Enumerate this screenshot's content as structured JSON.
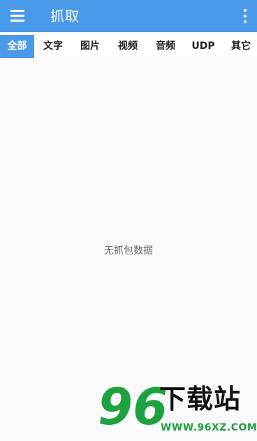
{
  "app_bar": {
    "title": "抓取",
    "menu_icon": "hamburger-menu-icon",
    "more_icon": "more-vert-icon",
    "color": "#4a9aea"
  },
  "tabs": [
    {
      "label": "全部",
      "active": true
    },
    {
      "label": "文字",
      "active": false
    },
    {
      "label": "图片",
      "active": false
    },
    {
      "label": "视频",
      "active": false
    },
    {
      "label": "音频",
      "active": false
    },
    {
      "label": "UDP",
      "active": false
    },
    {
      "label": "其它",
      "active": false
    }
  ],
  "main": {
    "empty_message": "无抓包数据"
  },
  "watermark": {
    "number": "96",
    "brand": "下载站",
    "url": "WWW.96XZ.COM"
  }
}
